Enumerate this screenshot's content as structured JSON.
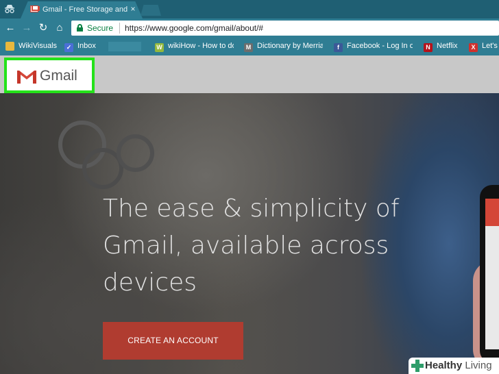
{
  "browser": {
    "tab": {
      "title": "Gmail - Free Storage and",
      "close": "×",
      "favicon": "gmail-favicon"
    },
    "incognito_icon": "incognito-icon",
    "nav": {
      "back": "←",
      "forward": "→",
      "reload": "↻",
      "home": "⌂"
    },
    "omnibox": {
      "secure_label": "Secure",
      "url": "https://www.google.com/gmail/about/#"
    },
    "bookmarks": [
      {
        "label": "WikiVisuals",
        "icon": "folder-icon",
        "glyph": "",
        "color": "#e8b83d"
      },
      {
        "label": "Inbox",
        "icon": "inbox-check-icon",
        "glyph": "✓",
        "color": "#4a6fd6"
      },
      {
        "label": "wikiHow - How to do",
        "icon": "wikihow-icon",
        "glyph": "W",
        "color": "#93b83d"
      },
      {
        "label": "Dictionary by Merria",
        "icon": "dictionary-icon",
        "glyph": "M",
        "color": "#6d6d6d"
      },
      {
        "label": "Facebook - Log In or",
        "icon": "facebook-icon",
        "glyph": "f",
        "color": "#3b5998"
      },
      {
        "label": "Netflix",
        "icon": "netflix-icon",
        "glyph": "N",
        "color": "#b5121b"
      },
      {
        "label": "Let's",
        "icon": "x-icon",
        "glyph": "X",
        "color": "#d0312d"
      }
    ]
  },
  "page": {
    "logo_text": "Gmail",
    "headline": "The ease & simplicity of Gmail, available across devices",
    "cta_label": "CREATE AN ACCOUNT"
  },
  "watermark": {
    "strong": "Healthy",
    "light": " Living"
  },
  "colors": {
    "highlight": "#25e21a",
    "cta": "#b03c30",
    "chrome": "#2f7d93"
  }
}
